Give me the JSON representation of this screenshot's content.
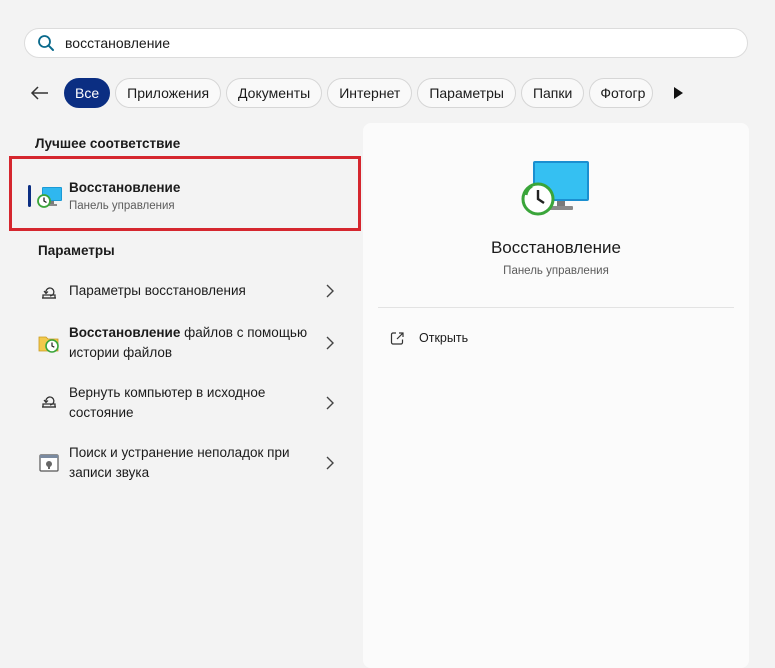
{
  "search": {
    "value": "восстановление"
  },
  "filters": {
    "back_label": "назад",
    "chips": [
      "Все",
      "Приложения",
      "Документы",
      "Интернет",
      "Параметры",
      "Папки",
      "Фотогр"
    ]
  },
  "best_match": {
    "heading": "Лучшее соответствие",
    "title": "Восстановление",
    "subtitle": "Панель управления"
  },
  "settings": {
    "heading": "Параметры",
    "items": [
      {
        "label": "Параметры восстановления",
        "icon": "recovery-settings-icon"
      },
      {
        "label_bold": "Восстановление",
        "label": " файлов с помощью истории файлов",
        "icon": "file-history-icon"
      },
      {
        "label": "Вернуть компьютер в исходное состояние",
        "icon": "reset-pc-icon"
      },
      {
        "label": "Поиск и устранение неполадок при записи звука",
        "icon": "troubleshoot-audio-icon"
      }
    ]
  },
  "details": {
    "title": "Восстановление",
    "subtitle": "Панель управления",
    "actions": [
      {
        "label": "Открыть",
        "icon": "open-external-icon"
      }
    ]
  },
  "colors": {
    "accent": "#0b2e82",
    "highlight_border": "#d5262e",
    "background": "#f3f3f3"
  }
}
